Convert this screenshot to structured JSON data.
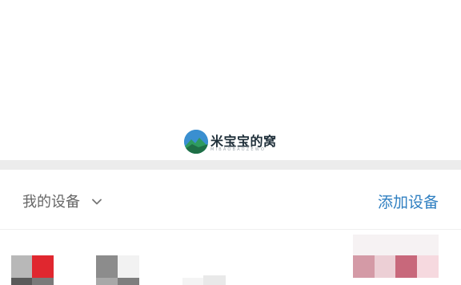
{
  "watermark": {
    "title": "米宝宝的窝",
    "subtitle": "MIBAOBAOZEWO"
  },
  "header": {
    "device_selector_label": "我的设备",
    "add_device_label": "添加设备"
  },
  "icons": {
    "dropdown": "chevron-down-icon",
    "watermark_logo": "mountain-logo-icon"
  },
  "colors": {
    "accent": "#2f7fc1",
    "separator": "#ececec",
    "label_gray": "#666666"
  }
}
